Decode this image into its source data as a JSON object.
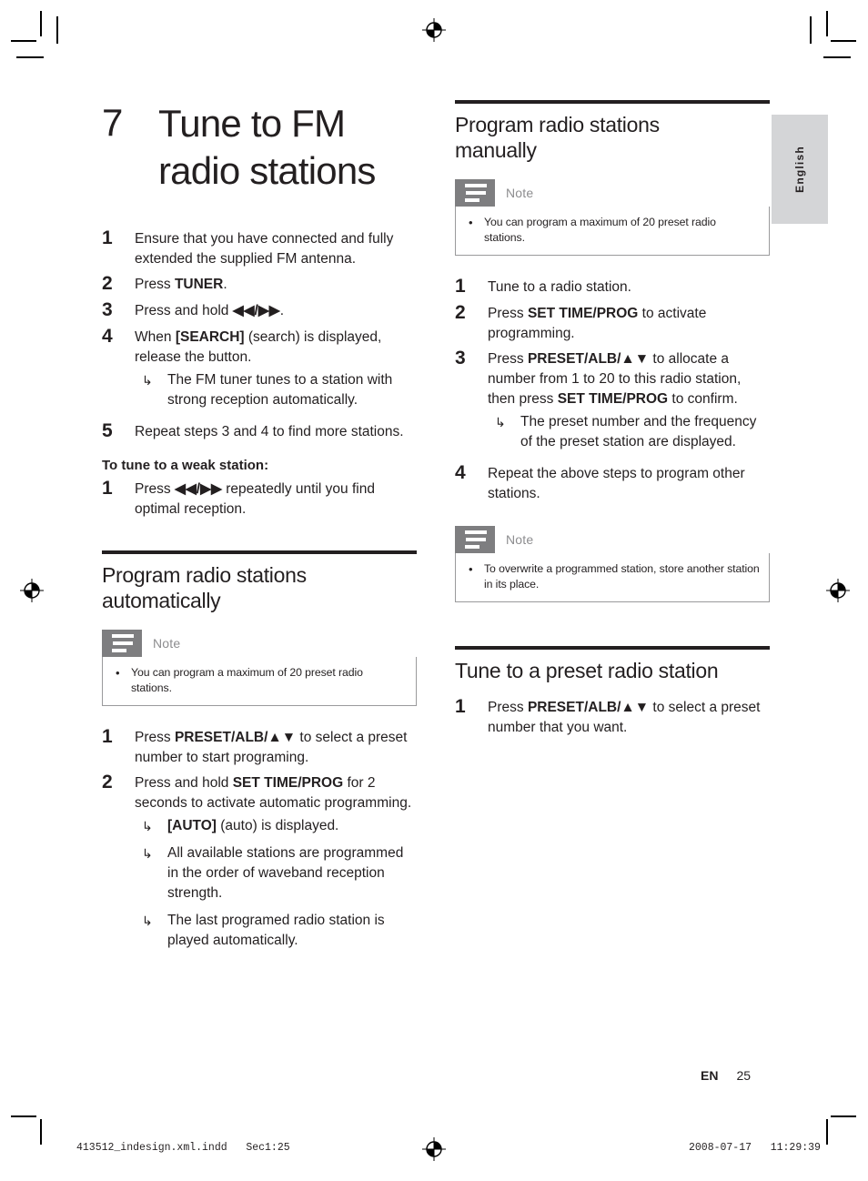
{
  "language_tab": {
    "label": "English"
  },
  "chapter": {
    "number": "7",
    "title_line1": "Tune to FM",
    "title_line2": "radio stations"
  },
  "left_column": {
    "intro_steps": [
      {
        "num": "1",
        "text": "Ensure that you have connected and fully extended the supplied FM antenna."
      },
      {
        "num": "2",
        "text_pre": "Press ",
        "bold": "TUNER",
        "text_post": "."
      },
      {
        "num": "3",
        "text_pre": "Press and hold ",
        "bold": "◀◀/▶▶",
        "text_post": "."
      },
      {
        "num": "4",
        "text_pre": "When ",
        "bold": "[SEARCH]",
        "text_post": " (search) is displayed, release the button.",
        "results": [
          {
            "arrow": "↳",
            "text": "The FM tuner tunes to a station with strong reception automatically."
          }
        ]
      },
      {
        "num": "5",
        "text": "Repeat steps 3 and 4 to find more stations."
      }
    ],
    "weak_station": {
      "heading": "To tune to a weak station:",
      "steps": [
        {
          "num": "1",
          "text_pre": "Press ",
          "bold": "◀◀/▶▶",
          "text_post": " repeatedly until you find optimal reception."
        }
      ]
    },
    "section": {
      "heading_line1": "Program radio stations",
      "heading_line2": "automatically",
      "note": {
        "label": "Note",
        "bullet": "•",
        "items": [
          "You can program a maximum of 20 preset radio stations."
        ]
      },
      "steps": [
        {
          "num": "1",
          "text_pre": "Press ",
          "bold": "PRESET/ALB/▲▼",
          "text_post": " to select a preset number to start programing."
        },
        {
          "num": "2",
          "text_pre": "Press and hold ",
          "bold": "SET TIME/PROG",
          "text_post": " for 2 seconds to activate automatic programming.",
          "results": [
            {
              "arrow": "↳",
              "bold": "[AUTO]",
              "text": " (auto) is displayed."
            },
            {
              "arrow": "↳",
              "text": "All available stations are programmed in the order of waveband reception strength."
            },
            {
              "arrow": "↳",
              "text": "The last programed radio station is played automatically."
            }
          ]
        }
      ]
    }
  },
  "right_column": {
    "section_manual": {
      "heading_line1": "Program radio stations",
      "heading_line2": "manually",
      "note": {
        "label": "Note",
        "bullet": "•",
        "items": [
          "You can program a maximum of 20 preset radio stations."
        ]
      },
      "steps": [
        {
          "num": "1",
          "text": "Tune to a radio station."
        },
        {
          "num": "2",
          "text_pre": "Press ",
          "bold": "SET TIME/PROG",
          "text_post": " to activate programming."
        },
        {
          "num": "3",
          "text_pre": "Press ",
          "bold": "PRESET/ALB/▲▼",
          "text_post": " to allocate a number from 1 to 20 to this radio station, then press ",
          "bold2": "SET TIME/PROG",
          "text_post2": " to confirm.",
          "results": [
            {
              "arrow": "↳",
              "text": "The preset number and the frequency of the preset station are displayed."
            }
          ]
        },
        {
          "num": "4",
          "text": "Repeat the above steps to program other stations."
        }
      ],
      "note2": {
        "label": "Note",
        "bullet": "•",
        "items": [
          "To overwrite a programmed station, store another station in its place."
        ]
      }
    },
    "section_preset": {
      "heading": "Tune to a preset radio station",
      "steps": [
        {
          "num": "1",
          "text_pre": "Press ",
          "bold": "PRESET/ALB/▲▼",
          "text_post": " to select a preset number that you want."
        }
      ]
    }
  },
  "footer": {
    "locale": "EN",
    "page_number": "25"
  },
  "printer_slug": {
    "left": "413512_indesign.xml.indd   Sec1:25",
    "right": "2008-07-17   11:29:39"
  },
  "colors": {
    "rule": "#231f20",
    "note_icon_bg": "#7e7e80",
    "note_label": "#8d8d8f",
    "lang_tab_bg": "#d4d5d7"
  }
}
